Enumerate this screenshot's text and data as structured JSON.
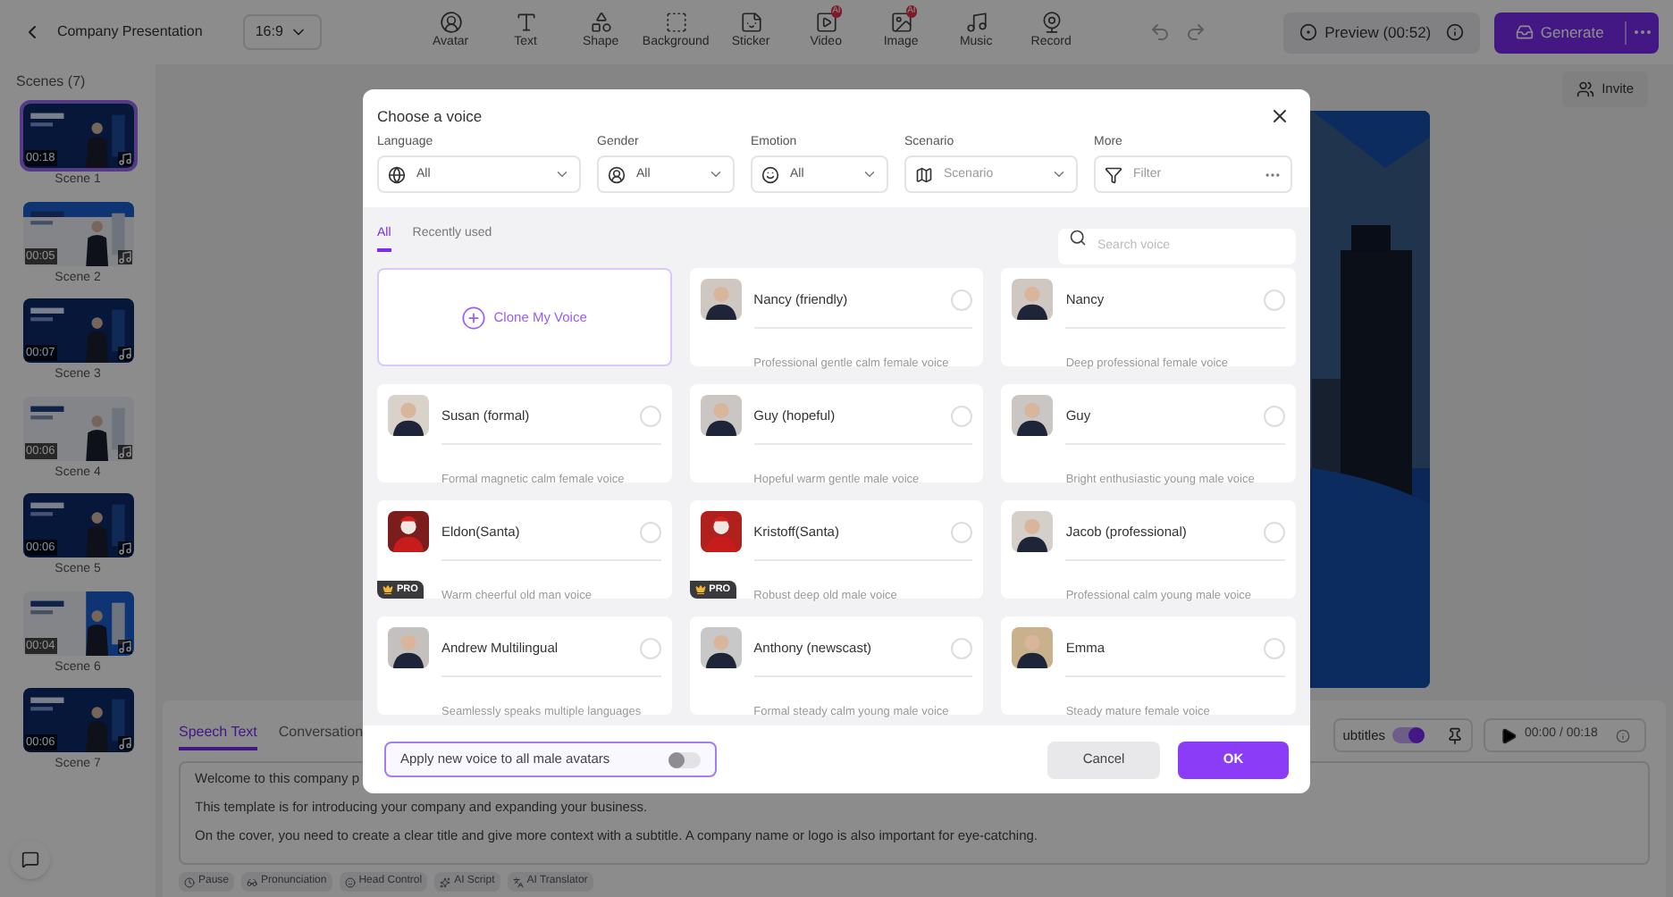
{
  "top_bar": {
    "project_title": "Company Presentation",
    "aspect_ratio": "16:9",
    "tools": [
      {
        "label": "Avatar"
      },
      {
        "label": "Text"
      },
      {
        "label": "Shape"
      },
      {
        "label": "Background"
      },
      {
        "label": "Sticker"
      },
      {
        "label": "Video",
        "badge": "AI"
      },
      {
        "label": "Image",
        "badge": "AI"
      },
      {
        "label": "Music"
      },
      {
        "label": "Record"
      }
    ],
    "preview": "Preview (00:52)",
    "generate": "Generate"
  },
  "scenes": {
    "title": "Scenes (7)",
    "items": [
      {
        "label": "Scene 1",
        "duration": "00:18",
        "selected": true
      },
      {
        "label": "Scene 2",
        "duration": "00:05",
        "selected": false
      },
      {
        "label": "Scene 3",
        "duration": "00:07",
        "selected": false
      },
      {
        "label": "Scene 4",
        "duration": "00:06",
        "selected": false
      },
      {
        "label": "Scene 5",
        "duration": "00:06",
        "selected": false
      },
      {
        "label": "Scene 6",
        "duration": "00:04",
        "selected": false
      },
      {
        "label": "Scene 7",
        "duration": "00:06",
        "selected": false
      }
    ]
  },
  "invite": "Invite",
  "speech_panel": {
    "tabs": [
      {
        "label": "Speech Text",
        "selected": true
      },
      {
        "label": "Conversation",
        "selected": false
      }
    ],
    "lines": [
      "Welcome to this company p",
      "This template is for introducing your company and expanding your business.",
      "On the cover, you need to create a clear title and give more context with a subtitle. A company name or logo is also important for eye-catching."
    ],
    "tools": [
      {
        "label": "Pause"
      },
      {
        "label": "Pronunciation"
      },
      {
        "label": "Head Control"
      },
      {
        "label": "AI Script"
      },
      {
        "label": "AI Translator"
      }
    ],
    "subtitles": {
      "label": "ubtitles",
      "on": true
    },
    "playback": "00:00 / 00:18"
  },
  "dialog": {
    "title": "Choose a voice",
    "filters": [
      {
        "label": "Language",
        "value": "All"
      },
      {
        "label": "Gender",
        "value": "All"
      },
      {
        "label": "Emotion",
        "value": "All"
      },
      {
        "label": "Scenario",
        "placeholder": "Scenario"
      },
      {
        "label": "More",
        "placeholder": "Filter",
        "kind": "more"
      }
    ],
    "tabs": [
      {
        "label": "All",
        "selected": true
      },
      {
        "label": "Recently used",
        "selected": false
      }
    ],
    "search": {
      "placeholder": "Search voice"
    },
    "clone": "Clone My Voice",
    "voices": [
      {
        "name": "Nancy (friendly)",
        "description": "Professional gentle calm female voice",
        "selected": false
      },
      {
        "name": "Nancy",
        "description": "Deep professional female voice",
        "selected": false
      },
      {
        "name": "Susan (formal)",
        "description": "Formal magnetic calm female voice",
        "selected": false
      },
      {
        "name": "Guy (hopeful)",
        "description": "Hopeful warm gentle male voice",
        "selected": false
      },
      {
        "name": "Guy",
        "description": "Bright enthusiastic young male voice",
        "selected": false
      },
      {
        "name": "Eldon(Santa)",
        "description": "Warm cheerful old man voice",
        "selected": false,
        "badge": "PRO"
      },
      {
        "name": "Kristoff(Santa)",
        "description": "Robust deep old male voice",
        "selected": false,
        "badge": "PRO"
      },
      {
        "name": "Jacob (professional)",
        "description": "Professional calm young male voice",
        "selected": false
      },
      {
        "name": "Andrew Multilingual",
        "description": "Seamlessly speaks multiple languages",
        "selected": false
      },
      {
        "name": "Anthony (newscast)",
        "description": "Formal steady calm young male voice",
        "selected": false
      },
      {
        "name": "Emma",
        "description": "Steady mature female voice",
        "selected": false
      }
    ],
    "apply": {
      "label": "Apply new voice to all male avatars",
      "on": false
    },
    "buttons": [
      {
        "label": "Cancel",
        "kind": "secondary"
      },
      {
        "label": "OK",
        "kind": "primary"
      }
    ]
  }
}
